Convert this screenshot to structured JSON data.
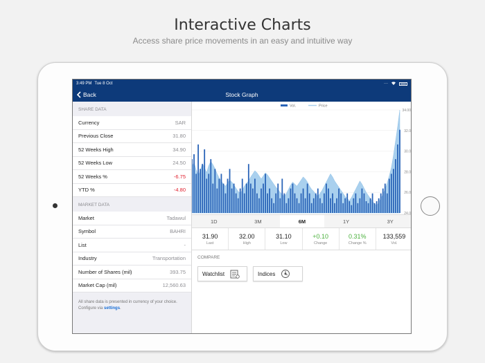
{
  "promo": {
    "title": "Interactive Charts",
    "subtitle": "Access share price movements in an easy and intuitive way"
  },
  "status_bar": {
    "time": "3:49 PM",
    "date": "Tue 8 Oct"
  },
  "nav": {
    "back_label": "Back",
    "title": "Stock Graph"
  },
  "share_data": {
    "header": "SHARE DATA",
    "rows": [
      {
        "label": "Currency",
        "value": "SAR",
        "negative": false
      },
      {
        "label": "Previous Close",
        "value": "31.80",
        "negative": false
      },
      {
        "label": "52 Weeks High",
        "value": "34.90",
        "negative": false
      },
      {
        "label": "52 Weeks Low",
        "value": "24.50",
        "negative": false
      },
      {
        "label": "52 Weeks %",
        "value": "-6.75",
        "negative": true
      },
      {
        "label": "YTD %",
        "value": "-4.80",
        "negative": true
      }
    ]
  },
  "market_data": {
    "header": "MARKET DATA",
    "rows": [
      {
        "label": "Market",
        "value": "Tadawul"
      },
      {
        "label": "Symbol",
        "value": "BAHRI"
      },
      {
        "label": "List",
        "value": "-"
      },
      {
        "label": "Industry",
        "value": "Transportation"
      },
      {
        "label": "Number of Shares (mil)",
        "value": "393.75"
      },
      {
        "label": "Market Cap (mil)",
        "value": "12,560.63"
      }
    ]
  },
  "note": {
    "text": "All share data is presented in currency of your choice. Configure via ",
    "link": "settings",
    "suffix": "."
  },
  "chart_data": {
    "type": "line",
    "legend": [
      "Vol.",
      "Price"
    ],
    "y_ticks": [
      "34.00",
      "32.0",
      "30.0",
      "28.0",
      "26.0",
      "24.0"
    ],
    "ylim": [
      24,
      34
    ],
    "price": [
      28.5,
      28.9,
      28.2,
      27.6,
      28.1,
      28.8,
      28.4,
      27.9,
      28.6,
      29.0,
      28.7,
      28.3,
      27.8,
      27.4,
      27.1,
      26.8,
      26.6,
      26.9,
      27.2,
      27.0,
      26.7,
      26.4,
      26.1,
      25.9,
      26.2,
      26.6,
      26.9,
      27.1,
      27.5,
      27.8,
      28.1,
      27.9,
      27.6,
      27.3,
      27.6,
      27.9,
      27.7,
      27.4,
      27.1,
      26.8,
      26.5,
      26.3,
      26.0,
      25.8,
      25.6,
      25.9,
      26.3,
      26.7,
      27.0,
      26.8,
      26.6,
      26.9,
      27.2,
      27.5,
      27.3,
      27.0,
      26.6,
      26.3,
      26.1,
      25.8,
      25.6,
      25.9,
      26.2,
      26.6,
      27.0,
      27.4,
      27.8,
      27.5,
      27.1,
      26.8,
      26.5,
      26.2,
      25.9,
      25.6,
      25.4,
      25.2,
      25.5,
      25.9,
      26.3,
      26.7,
      27.1,
      26.8,
      26.4,
      26.0,
      25.7,
      25.4,
      25.1,
      24.9,
      24.7,
      25.0,
      25.4,
      25.8,
      26.3,
      26.9,
      27.6,
      28.4,
      29.6,
      31.0,
      32.4,
      34.0
    ],
    "volume": [
      0.55,
      0.6,
      0.4,
      0.7,
      0.45,
      0.5,
      0.65,
      0.35,
      0.4,
      0.55,
      0.3,
      0.45,
      0.25,
      0.35,
      0.4,
      0.3,
      0.2,
      0.35,
      0.45,
      0.25,
      0.3,
      0.2,
      0.15,
      0.25,
      0.35,
      0.2,
      0.3,
      0.5,
      0.3,
      0.25,
      0.35,
      0.2,
      0.15,
      0.25,
      0.3,
      0.4,
      0.2,
      0.25,
      0.15,
      0.1,
      0.2,
      0.3,
      0.15,
      0.35,
      0.2,
      0.1,
      0.15,
      0.25,
      0.3,
      0.2,
      0.15,
      0.1,
      0.2,
      0.25,
      0.15,
      0.3,
      0.2,
      0.1,
      0.15,
      0.2,
      0.25,
      0.15,
      0.1,
      0.2,
      0.3,
      0.25,
      0.15,
      0.2,
      0.1,
      0.15,
      0.25,
      0.2,
      0.1,
      0.15,
      0.2,
      0.12,
      0.08,
      0.15,
      0.2,
      0.1,
      0.15,
      0.25,
      0.2,
      0.12,
      0.1,
      0.15,
      0.2,
      0.1,
      0.12,
      0.15,
      0.2,
      0.25,
      0.3,
      0.2,
      0.35,
      0.4,
      0.45,
      0.55,
      0.7,
      0.85
    ],
    "volume_max": 1
  },
  "range_tabs": {
    "items": [
      "1D",
      "3M",
      "6M",
      "1Y",
      "3Y"
    ],
    "active": "6M"
  },
  "stats": [
    {
      "value": "31.90",
      "label": "Last",
      "positive": false
    },
    {
      "value": "32.00",
      "label": "High",
      "positive": false
    },
    {
      "value": "31.10",
      "label": "Low",
      "positive": false
    },
    {
      "value": "+0.10",
      "label": "Change",
      "positive": true
    },
    {
      "value": "0.31%",
      "label": "Change %",
      "positive": true
    },
    {
      "value": "133,559",
      "label": "Vol.",
      "positive": false
    }
  ],
  "compare": {
    "header": "COMPARE",
    "watchlist_label": "Watchlist",
    "indices_label": "Indices"
  },
  "colors": {
    "nav_bg": "#0d3a7a",
    "volume_bar": "#2a64b8",
    "price_area": "#a9d0ee",
    "negative": "#e0202e",
    "positive": "#49b03b",
    "link": "#1a6fd6"
  }
}
